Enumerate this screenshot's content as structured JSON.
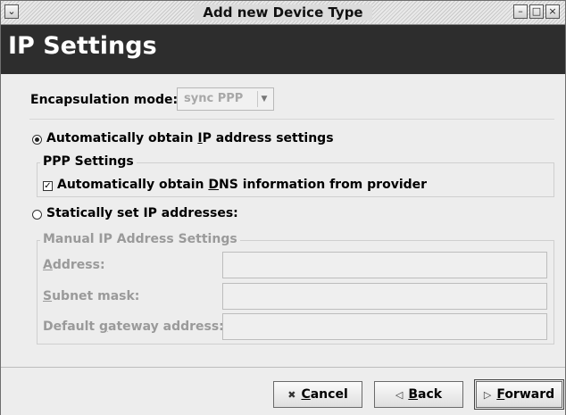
{
  "window": {
    "title": "Add new Device Type"
  },
  "header": {
    "title": "IP Settings"
  },
  "encapsulation": {
    "label": "Encapsulation mode:",
    "value": "sync PPP"
  },
  "auto_ip": {
    "label_pre": "Automatically obtain ",
    "label_mn": "I",
    "label_post": "P address settings",
    "selected": true
  },
  "ppp_settings": {
    "title": "PPP Settings",
    "dns_label_pre": "Automatically obtain ",
    "dns_label_mn": "D",
    "dns_label_post": "NS information from provider",
    "dns_checked": true
  },
  "static_ip": {
    "label": "Statically set IP addresses:",
    "selected": false
  },
  "manual": {
    "title": "Manual IP Address Settings",
    "address_mn": "A",
    "address_rest": "ddress:",
    "address_value": "",
    "subnet_mn": "S",
    "subnet_rest": "ubnet mask:",
    "subnet_value": "",
    "gateway_pre": "Default ",
    "gateway_mn": "g",
    "gateway_post": "ateway address:",
    "gateway_value": ""
  },
  "buttons": {
    "cancel_mn": "C",
    "cancel_rest": "ancel",
    "back_mn": "B",
    "back_rest": "ack",
    "forward_mn": "F",
    "forward_rest": "orward"
  },
  "icons": {
    "window_menu": "chevron-down-icon",
    "minimize": "minimize-icon",
    "maximize": "maximize-icon",
    "close": "close-icon",
    "cancel": "close-icon",
    "back": "arrow-left-icon",
    "forward": "arrow-right-icon"
  }
}
